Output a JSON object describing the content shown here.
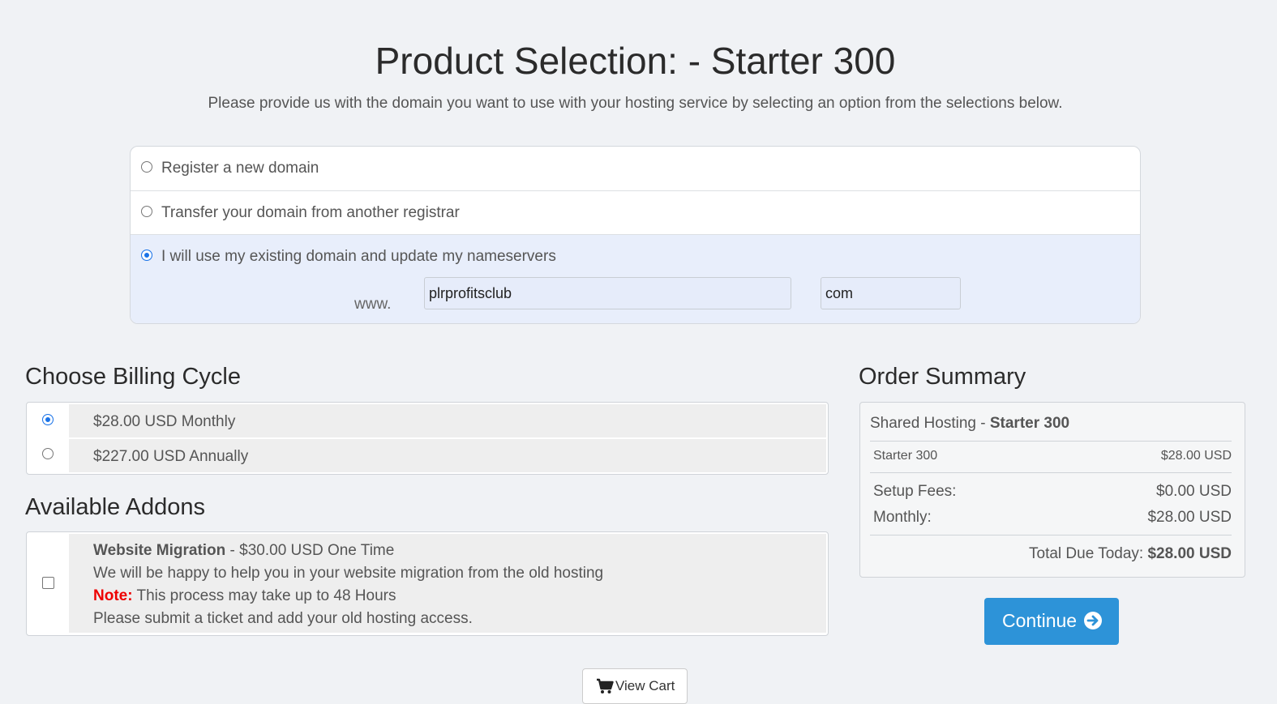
{
  "header": {
    "title": "Product Selection: - Starter 300",
    "subtitle": "Please provide us with the domain you want to use with your hosting service by selecting an option from the selections below."
  },
  "domain": {
    "options": [
      {
        "label": "Register a new domain",
        "checked": false
      },
      {
        "label": "Transfer your domain from another registrar",
        "checked": false
      },
      {
        "label": "I will use my existing domain and update my nameservers",
        "checked": true
      }
    ],
    "www_prefix": "www.",
    "sld_value": "plrprofitsclub",
    "tld_value": "com"
  },
  "billing": {
    "heading": "Choose Billing Cycle",
    "options": [
      {
        "label": "$28.00 USD Monthly",
        "checked": true
      },
      {
        "label": "$227.00 USD Annually",
        "checked": false
      }
    ]
  },
  "addons": {
    "heading": "Available Addons",
    "items": [
      {
        "name": "Website Migration",
        "price": " - $30.00 USD One Time",
        "line1": "We will be happy to help you in your website migration from the old hosting",
        "note_label": "Note:",
        "note_text": " This process may take up to 48 Hours",
        "line3": "Please submit a ticket and add your old hosting access.",
        "checked": false
      }
    ]
  },
  "summary": {
    "heading": "Order Summary",
    "category": "Shared Hosting - ",
    "product": "Starter 300",
    "line_item_label": "Starter 300",
    "line_item_price": "$28.00 USD",
    "setup_label": "Setup Fees:",
    "setup_value": "$0.00 USD",
    "monthly_label": "Monthly:",
    "monthly_value": "$28.00 USD",
    "total_label": "Total Due Today: ",
    "total_value": "$28.00 USD"
  },
  "actions": {
    "continue_label": "Continue",
    "view_cart_label": "View Cart"
  },
  "colors": {
    "primary_button": "#2d93d8",
    "note_red": "#ee0000",
    "selected_option_bg": "#e8eefb"
  }
}
